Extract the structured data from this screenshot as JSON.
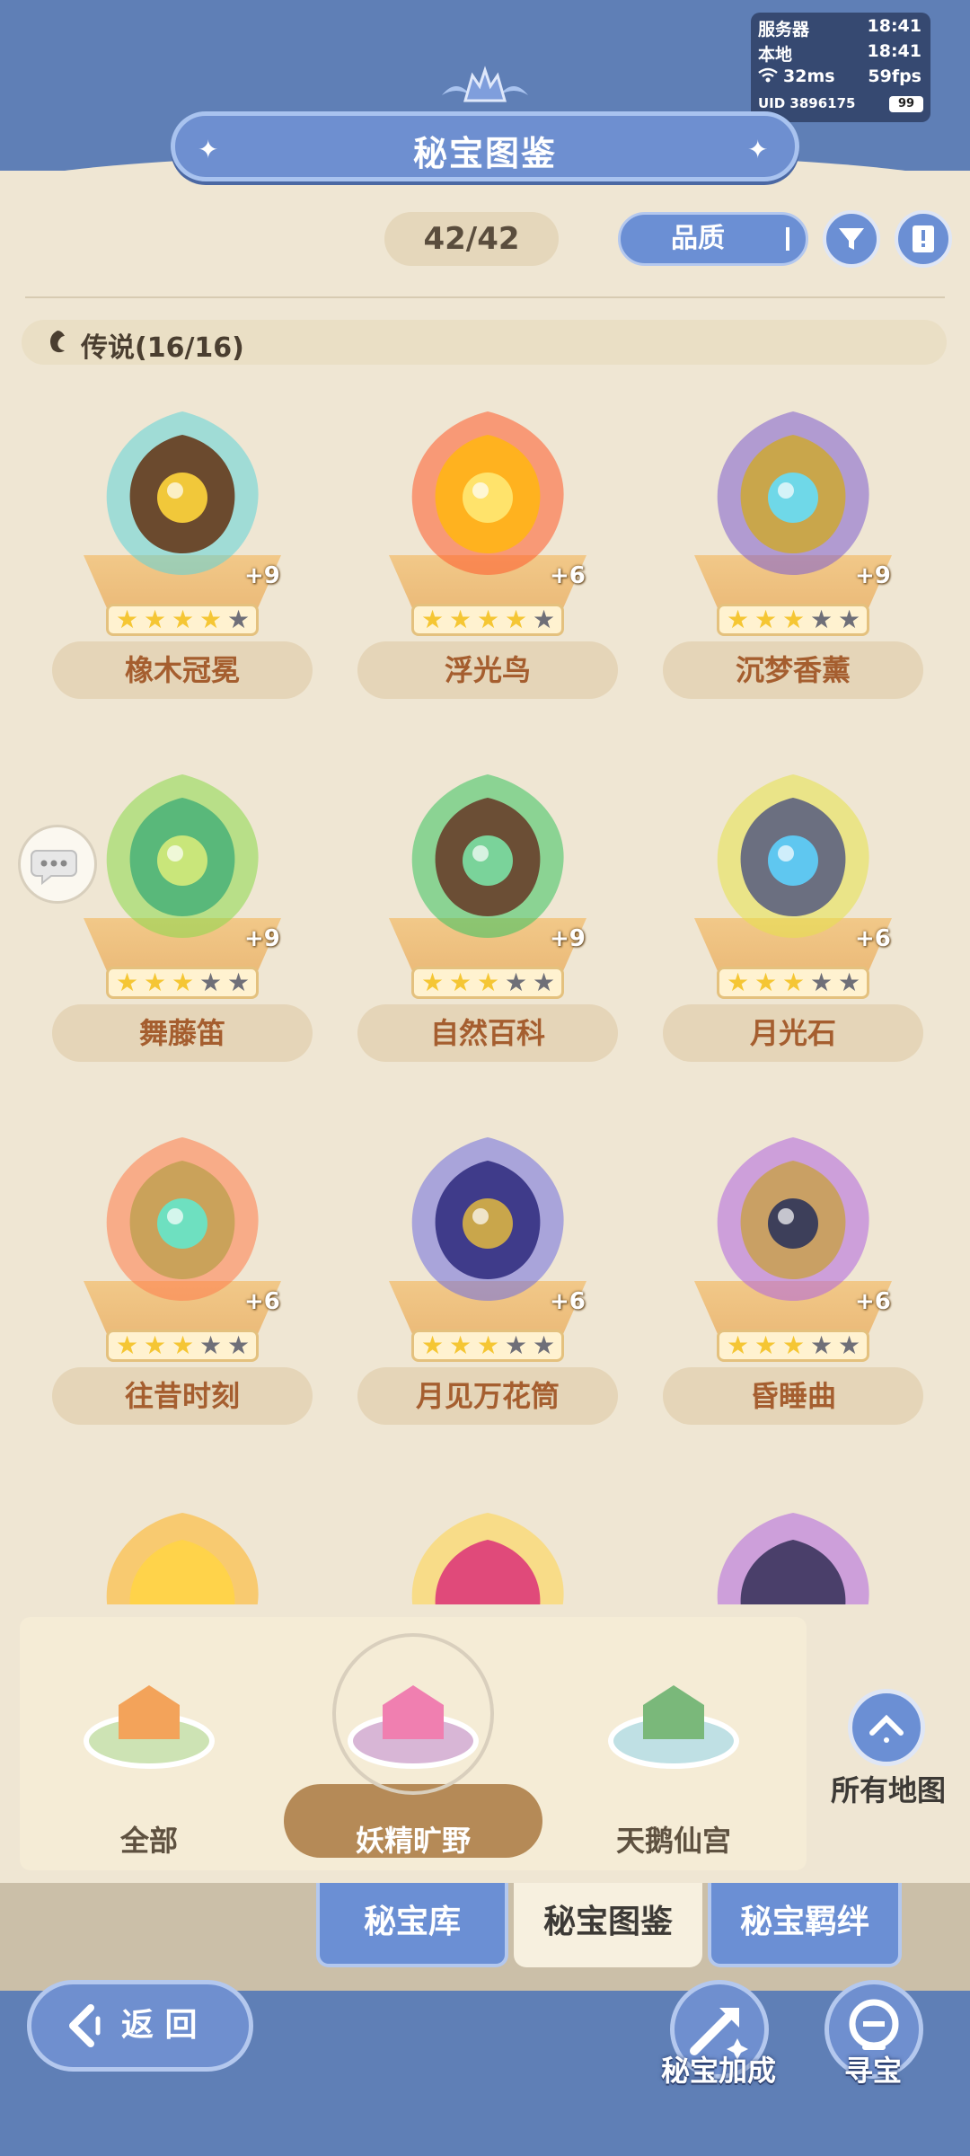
{
  "status": {
    "server_label": "服务器",
    "server_time": "18:41",
    "local_label": "本地",
    "local_time": "18:41",
    "ping": "32ms",
    "fps": "59fps",
    "uid": "UID 3896175",
    "battery": "99"
  },
  "header": {
    "title": "秘宝图鉴"
  },
  "toolbar": {
    "counter": "42/42",
    "sort_label": "品质",
    "filter_icon": "filter-icon",
    "book_icon": "book-icon"
  },
  "section": {
    "title": "传说(16/16)",
    "icon": "legend-icon"
  },
  "items": [
    {
      "name": "橡木冠冕",
      "plus": "+9",
      "stars_filled": 4,
      "stars_total": 5,
      "glow": "#5fd3d8",
      "main": "#6b4a2e",
      "accent": "#f1c83a"
    },
    {
      "name": "浮光鸟",
      "plus": "+6",
      "stars_filled": 4,
      "stars_total": 5,
      "glow": "#ff5a2a",
      "main": "#ffb21f",
      "accent": "#ffe36b"
    },
    {
      "name": "沉梦香薰",
      "plus": "+9",
      "stars_filled": 3,
      "stars_total": 5,
      "glow": "#7d5ccf",
      "main": "#c9a64b",
      "accent": "#6fd8e8"
    },
    {
      "name": "舞藤笛",
      "plus": "+9",
      "stars_filled": 3,
      "stars_total": 5,
      "glow": "#8ad94a",
      "main": "#59b87a",
      "accent": "#c9e67a"
    },
    {
      "name": "自然百科",
      "plus": "+9",
      "stars_filled": 3,
      "stars_total": 5,
      "glow": "#39c25f",
      "main": "#6b4e35",
      "accent": "#7ad39a"
    },
    {
      "name": "月光石",
      "plus": "+6",
      "stars_filled": 3,
      "stars_total": 5,
      "glow": "#e6e24a",
      "main": "#6b6f80",
      "accent": "#5fc7f0"
    },
    {
      "name": "往昔时刻",
      "plus": "+6",
      "stars_filled": 3,
      "stars_total": 5,
      "glow": "#ff7b4a",
      "main": "#caa25a",
      "accent": "#6ee0c0"
    },
    {
      "name": "月见万花筒",
      "plus": "+6",
      "stars_filled": 3,
      "stars_total": 5,
      "glow": "#6f6ee0",
      "main": "#3f3b8a",
      "accent": "#c9a64b"
    },
    {
      "name": "昏睡曲",
      "plus": "+6",
      "stars_filled": 3,
      "stars_total": 5,
      "glow": "#b065e0",
      "main": "#c9a064",
      "accent": "#3d3f5a"
    }
  ],
  "peek_items": [
    {
      "glow": "#ffb21f",
      "main": "#ffd34a"
    },
    {
      "glow": "#ffd34a",
      "main": "#e04a7a"
    },
    {
      "glow": "#b065e0",
      "main": "#4a3f6a"
    }
  ],
  "maps": {
    "items": [
      {
        "label": "全部",
        "selected": false
      },
      {
        "label": "妖精旷野",
        "selected": true
      },
      {
        "label": "天鹅仙宫",
        "selected": false
      }
    ],
    "all_maps_label": "所有地图"
  },
  "tabs": [
    {
      "label": "秘宝库",
      "active": false
    },
    {
      "label": "秘宝图鉴",
      "active": true
    },
    {
      "label": "秘宝羁绊",
      "active": false
    }
  ],
  "footer": {
    "back_label": "返 回",
    "boost_label": "秘宝加成",
    "hunt_label": "寻宝"
  },
  "colors": {
    "primary_blue": "#6b8fd4",
    "band_blue": "#5f7fb6",
    "parchment": "#efe6d3",
    "name_text": "#a55e2f",
    "star_filled": "#f5c634",
    "star_empty": "#6f6f78"
  }
}
